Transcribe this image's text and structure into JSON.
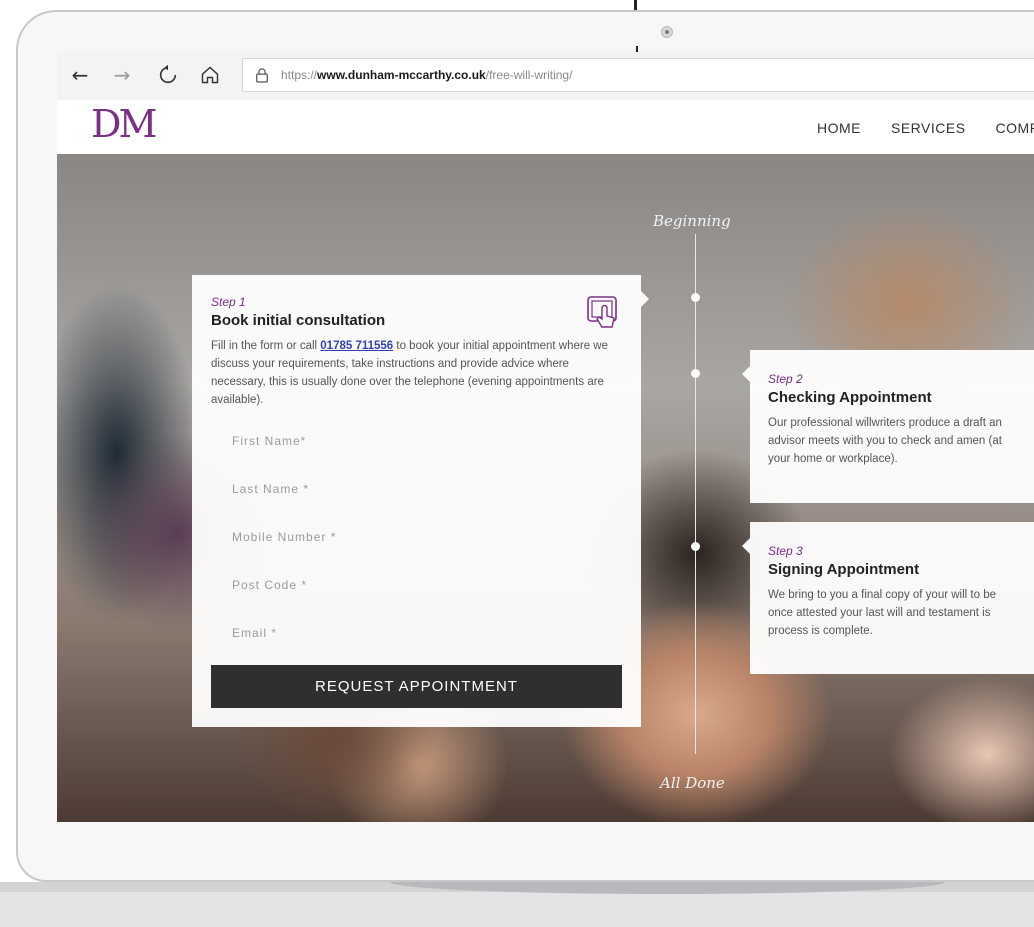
{
  "browser": {
    "url_scheme": "https://",
    "url_domain": "www.dunham-mccarthy.co.uk",
    "url_path": "/free-will-writing/",
    "icons": [
      "back-arrow-icon",
      "forward-arrow-icon",
      "refresh-icon",
      "home-icon",
      "lock-icon"
    ]
  },
  "site": {
    "logo": "DM",
    "nav": [
      "HOME",
      "SERVICES",
      "COMP"
    ]
  },
  "timeline": {
    "start_label": "Beginning",
    "end_label": "All Done"
  },
  "step1": {
    "step": "Step 1",
    "title": "Book initial consultation",
    "body_prefix": "Fill in the form or call ",
    "phone": "01785 711556",
    "body_suffix": " to book your initial appointment where we discuss your requirements, take instructions and provide advice where necessary, this is usually done over the telephone (evening appointments are available)."
  },
  "form": {
    "fields": [
      "First Name*",
      "Last Name *",
      "Mobile Number *",
      "Post Code *",
      "Email *"
    ],
    "submit": "REQUEST APPOINTMENT"
  },
  "step2": {
    "step": "Step 2",
    "title": "Checking Appointment",
    "body": "Our professional willwriters produce a draft an advisor meets with you to check and amen (at your home or workplace)."
  },
  "step3": {
    "step": "Step 3",
    "title": "Signing Appointment",
    "body": "We bring to you a final copy of your will to be once attested your last will and testament is process is complete."
  }
}
